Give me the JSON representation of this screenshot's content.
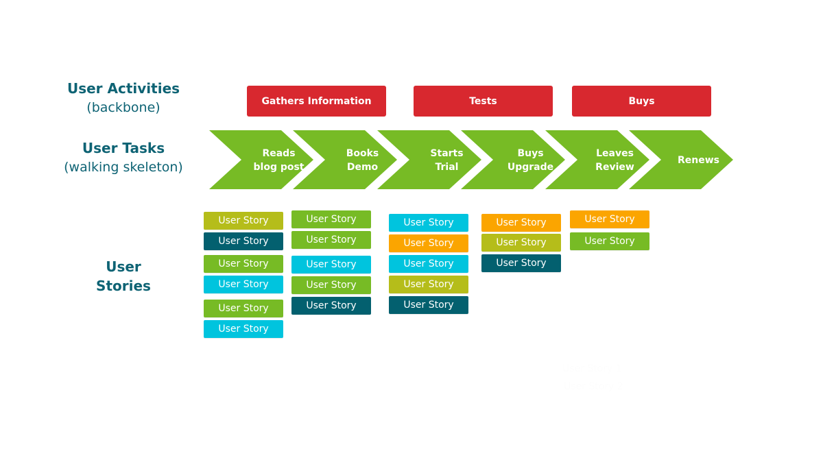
{
  "colors": {
    "heading": "#0E6374",
    "activity": "#D8282F",
    "task": "#77BB25",
    "olive": "#B5BD1A",
    "teal": "#03606F",
    "green": "#77BB25",
    "cyan": "#00C4DE",
    "orange": "#FBA500"
  },
  "labels": {
    "activities": {
      "title": "User Activities",
      "subtitle": "(backbone)"
    },
    "tasks": {
      "title": "User Tasks",
      "subtitle": "(walking skeleton)"
    },
    "stories": {
      "line1": "User",
      "line2": "Stories"
    }
  },
  "activities": [
    {
      "label": "Gathers Information"
    },
    {
      "label": "Tests"
    },
    {
      "label": "Buys"
    }
  ],
  "tasks": [
    {
      "lines": [
        "Reads",
        "blog post"
      ]
    },
    {
      "lines": [
        "Books",
        "Demo"
      ]
    },
    {
      "lines": [
        "Starts",
        "Trial"
      ]
    },
    {
      "lines": [
        "Buys",
        "Upgrade"
      ]
    },
    {
      "lines": [
        "Leaves",
        "Review"
      ]
    },
    {
      "lines": [
        "Renews"
      ]
    }
  ],
  "story_columns": [
    {
      "stories": [
        {
          "label": "User Story",
          "color": "olive"
        },
        {
          "label": "User Story",
          "color": "teal"
        },
        {
          "label": "User Story",
          "color": "green"
        },
        {
          "label": "User Story",
          "color": "cyan"
        },
        {
          "label": "User Story",
          "color": "green"
        },
        {
          "label": "User Story",
          "color": "cyan"
        }
      ]
    },
    {
      "stories": [
        {
          "label": "User Story",
          "color": "green"
        },
        {
          "label": "User Story",
          "color": "green"
        },
        {
          "label": "User Story",
          "color": "cyan"
        },
        {
          "label": "User Story",
          "color": "green"
        },
        {
          "label": "User Story",
          "color": "teal"
        }
      ]
    },
    {
      "stories": [
        {
          "label": "User Story",
          "color": "cyan"
        },
        {
          "label": "User Story",
          "color": "orange"
        },
        {
          "label": "User Story",
          "color": "cyan"
        },
        {
          "label": "User Story",
          "color": "olive"
        },
        {
          "label": "User Story",
          "color": "teal"
        }
      ]
    },
    {
      "stories": [
        {
          "label": "User Story",
          "color": "orange"
        },
        {
          "label": "User Story",
          "color": "olive"
        },
        {
          "label": "User Story",
          "color": "teal"
        }
      ]
    },
    {
      "stories": [
        {
          "label": "User Story",
          "color": "orange"
        },
        {
          "label": "User Story",
          "color": "green"
        }
      ]
    }
  ],
  "ghost_text": [
    "User Story 1",
    "User Story 2"
  ]
}
